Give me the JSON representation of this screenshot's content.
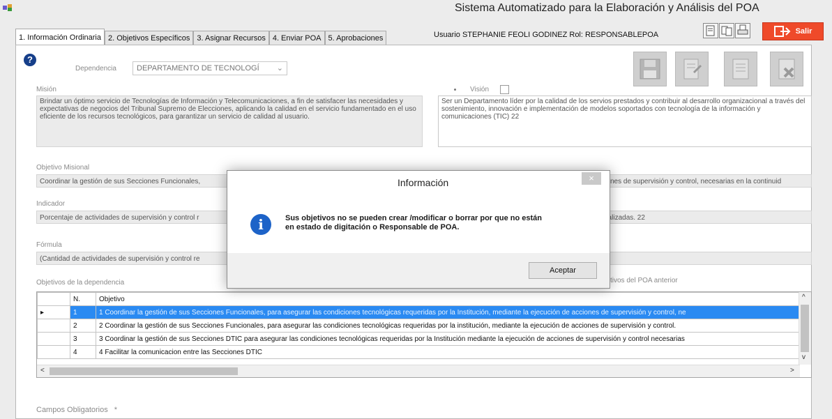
{
  "window": {
    "title": "Sistema Automatizado para la Elaboración y Análisis del POA"
  },
  "tabs": [
    {
      "label": "1. Información Ordinaria",
      "active": true
    },
    {
      "label": "2. Objetivos Específicos",
      "active": false
    },
    {
      "label": "3. Asignar Recursos",
      "active": false
    },
    {
      "label": "4. Enviar POA",
      "active": false
    },
    {
      "label": "5. Aprobaciones",
      "active": false
    }
  ],
  "user": {
    "text": "Usuario STEPHANIE FEOLI GODINEZ  Rol: RESPONSABLEPOA"
  },
  "toolbar": {
    "salir_label": "Salir",
    "salir_color": "#ef4a2a"
  },
  "form": {
    "help_glyph": "?",
    "dependencia_label": "Dependencia",
    "dependencia_value": "DEPARTAMENTO DE TECNOLOGÍ",
    "mision_label": "Misión",
    "mision_text": "Brindar un óptimo servicio de Tecnologías de Información y Telecomunicaciones, a fin de satisfacer las necesidades y expectativas de negocios del Tribunal Supremo de Elecciones, aplicando la calidad en el servicio fundamentado en el uso eficiente de los recursos tecnológicos, para garantizar un servicio de calidad al usuario.",
    "vision_label": "Visión",
    "vision_text": "Ser un Departamento líder por la calidad de los servios prestados y contribuir al desarrollo organizacional a través del sostenimiento, innovación e implementación de modelos soportados con tecnología de la información y comunicaciones (TIC) 22",
    "objetivo_misional_label": "Objetivo Misional",
    "objetivo_misional_text": "Coordinar la gestión de sus Secciones Funcionales,",
    "objetivo_misional_tail": "nes de supervisión y control, necesarias en la continuid",
    "indicador_label": "Indicador",
    "indicador_text": "Porcentaje de actividades de supervisión y control r",
    "indicador_tail": "ealizadas. 22",
    "formula_label": "Fórmula",
    "formula_text": "(Cantidad de actividades de supervisión y control re",
    "objetivos_dep_label": "Objetivos de la dependencia",
    "objetivos_poa_label": "tivos del POA anterior",
    "campos_label": "Campos Obligatorios",
    "campos_mark": "*"
  },
  "grid": {
    "headers": [
      "N.",
      "Objetivo"
    ],
    "rows": [
      {
        "n": "1",
        "objetivo": "1 Coordinar la gestión de sus Secciones Funcionales, para asegurar las condiciones tecnológicas requeridas por la Institución, mediante la ejecución de acciones de supervisión y control, ne",
        "selected": true
      },
      {
        "n": "2",
        "objetivo": "2 Coordinar la gestión de sus Secciones Funcionales, para asegurar las condiciones tecnológicas requeridas por la institución, mediante la ejecución de acciones de supervisión y control.",
        "selected": false
      },
      {
        "n": "3",
        "objetivo": "3 Coordinar la gestión de sus Secciones DTIC para asegurar las condiciones tecnológicas requeridas por la Institución mediante la ejecución de acciones de supervisión y control necesarias",
        "selected": false
      },
      {
        "n": "4",
        "objetivo": "4 Facilitar la comunicacion entre las Secciones DTIC",
        "selected": false
      }
    ],
    "selection_color": "#2a8af2"
  },
  "dialog": {
    "title": "Información",
    "close_glyph": "×",
    "info_glyph": "i",
    "message_line1": "Sus objetivos no se pueden crear /modificar o borrar  por que no están",
    "message_line2": "en estado de digitación o Responsable de POA.",
    "ok_label": "Aceptar"
  }
}
